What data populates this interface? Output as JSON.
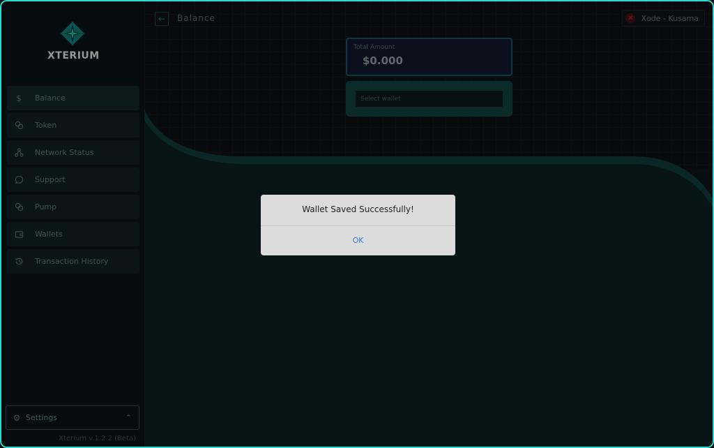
{
  "app": {
    "logo_text": "XTERIUM",
    "version": "Xterium v.1.2.2 (Beta)"
  },
  "sidebar": {
    "items": [
      {
        "label": "Balance",
        "icon": "dollar-icon"
      },
      {
        "label": "Token",
        "icon": "coins-icon"
      },
      {
        "label": "Network Status",
        "icon": "network-icon"
      },
      {
        "label": "Support",
        "icon": "chat-icon"
      },
      {
        "label": "Pump",
        "icon": "coins-icon"
      },
      {
        "label": "Wallets",
        "icon": "wallet-icon"
      },
      {
        "label": "Transaction History",
        "icon": "history-icon"
      }
    ],
    "settings_label": "Settings"
  },
  "header": {
    "back_icon": "arrow-left-icon",
    "title": "Balance",
    "network_label": "Xode - Kusama"
  },
  "main": {
    "total_amount_label": "Total Amount",
    "total_amount_value": "$0.000",
    "wallet_select_placeholder": "Select wallet"
  },
  "dialog": {
    "message": "Wallet Saved Successfully!",
    "ok_label": "OK"
  },
  "colors": {
    "accent": "#2fd8d0",
    "teal_dark": "#0f3a3a",
    "dialog_bg": "#dcdcdc",
    "ok_blue": "#3a7bd5"
  }
}
